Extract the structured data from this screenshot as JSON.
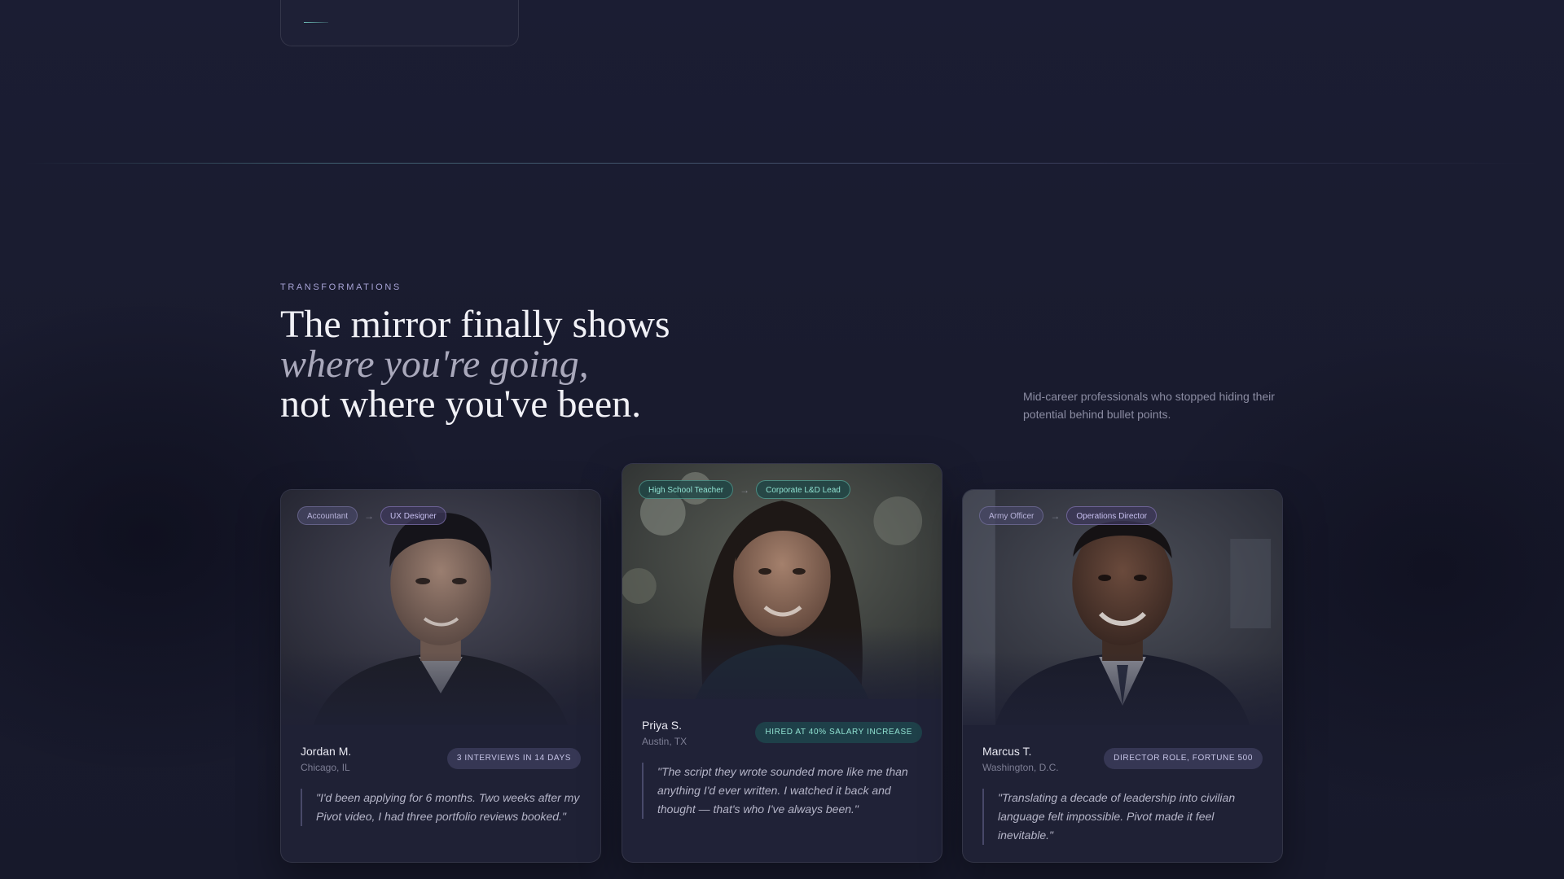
{
  "section": {
    "eyebrow": "TRANSFORMATIONS",
    "headline_line1": "The mirror finally shows",
    "headline_line2": "where you're going,",
    "headline_line3": "not where you've been.",
    "subtext": "Mid-career professionals who stopped hiding their potential behind bullet points."
  },
  "cards": [
    {
      "from_role": "Accountant",
      "to_role": "UX Designer",
      "name": "Jordan M.",
      "location": "Chicago, IL",
      "badge": "3 INTERVIEWS IN 14 DAYS",
      "quote": "\"I'd been applying for 6 months. Two weeks after my Pivot video, I had three portfolio reviews booked.\""
    },
    {
      "from_role": "High School Teacher",
      "to_role": "Corporate L&D Lead",
      "name": "Priya S.",
      "location": "Austin, TX",
      "badge": "HIRED AT 40% SALARY INCREASE",
      "quote": "\"The script they wrote sounded more like me than anything I'd ever written. I watched it back and thought — that's who I've always been.\""
    },
    {
      "from_role": "Army Officer",
      "to_role": "Operations Director",
      "name": "Marcus T.",
      "location": "Washington, D.C.",
      "badge": "DIRECTOR ROLE, FORTUNE 500",
      "quote": "\"Translating a decade of leadership into civilian language felt impossible. Pivot made it feel inevitable.\""
    }
  ],
  "icons": {
    "arrow": "arrow-right-icon"
  },
  "colors": {
    "accent_teal": "#8fe0d0",
    "accent_violet": "#a8a4d6",
    "background": "#181a2c"
  }
}
